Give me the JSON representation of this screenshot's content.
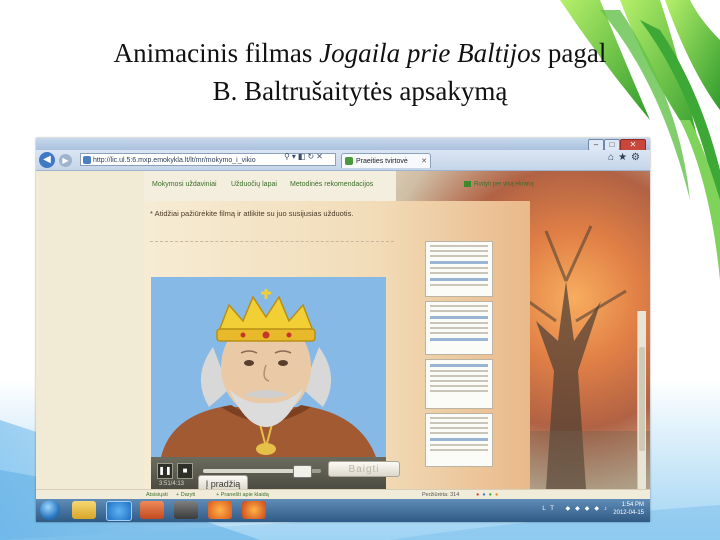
{
  "slide": {
    "title_prefix": "Animacinis filmas ",
    "title_italic": "Jogaila prie Baltijos",
    "title_suffix": " pagal",
    "title_line2": "B. Baltrušaitytės apsakymą"
  },
  "browser": {
    "url": "http://lic.ul.5:6.mxp.emokykla.lt/lt/mr/mokymo_i_vikio",
    "tab_label": "Praeities tvirtovė",
    "tool_icons": [
      "home-icon",
      "star-icon",
      "gear-icon"
    ]
  },
  "page": {
    "menu": [
      "Mokymosi uždaviniai",
      "Užduočių lapai",
      "Metodinės rekomendacijos"
    ],
    "download_label": "Rodyti per visą ekraną",
    "instruction": "* Atidžiai pažiūrėkite filmą ir atlikite su juo susijusias užduotis.",
    "timecode": "3:51/4:13",
    "progress_fraction": 0.83,
    "start_button": "Į pradžią",
    "finish_button": "Baigti"
  },
  "footer": {
    "left_items": [
      "Atsisiųsti",
      "Daryti",
      "Pranešti apie klaidą"
    ],
    "right_text": "Peržiūrėta: 314"
  },
  "taskbar": {
    "language": "LT",
    "time": "1:54 PM",
    "date": "2012-04-15"
  },
  "colors": {
    "sky": "#87b9e6",
    "menu_green": "#3d6e2b",
    "taskbar": "#2f5a85",
    "crown": "#f2cf34"
  }
}
